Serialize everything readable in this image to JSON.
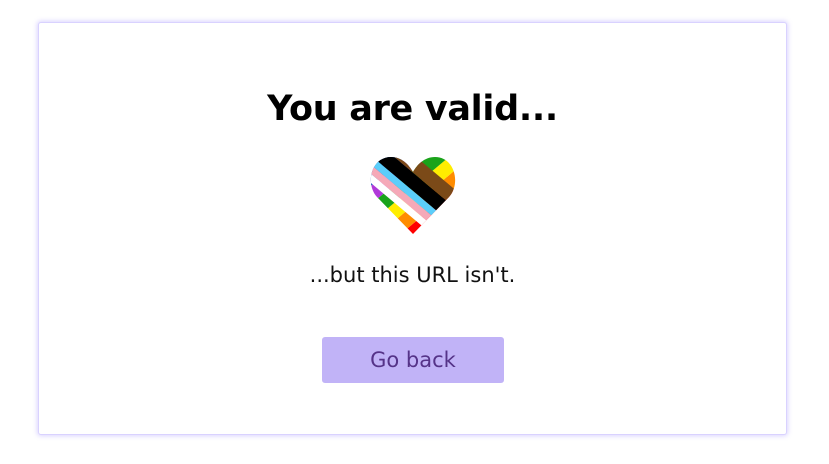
{
  "page": {
    "heading": "You are valid...",
    "subheading": "...but this URL isn't.",
    "back_button_label": "Go back",
    "heart_icon": "progress-pride-heart-icon"
  },
  "colors": {
    "card_border": "#d9d2ff",
    "button_bg": "#c1b3f7",
    "button_text": "#553388",
    "pride_stripes": [
      "#ff0000",
      "#ff8c00",
      "#ffed00",
      "#1aa31a",
      "#b03ad9",
      "#0047b3"
    ],
    "progress_chevron": [
      "#ffffff",
      "#f5a9b8",
      "#5bcefa",
      "#7b4a18",
      "#000000"
    ]
  }
}
